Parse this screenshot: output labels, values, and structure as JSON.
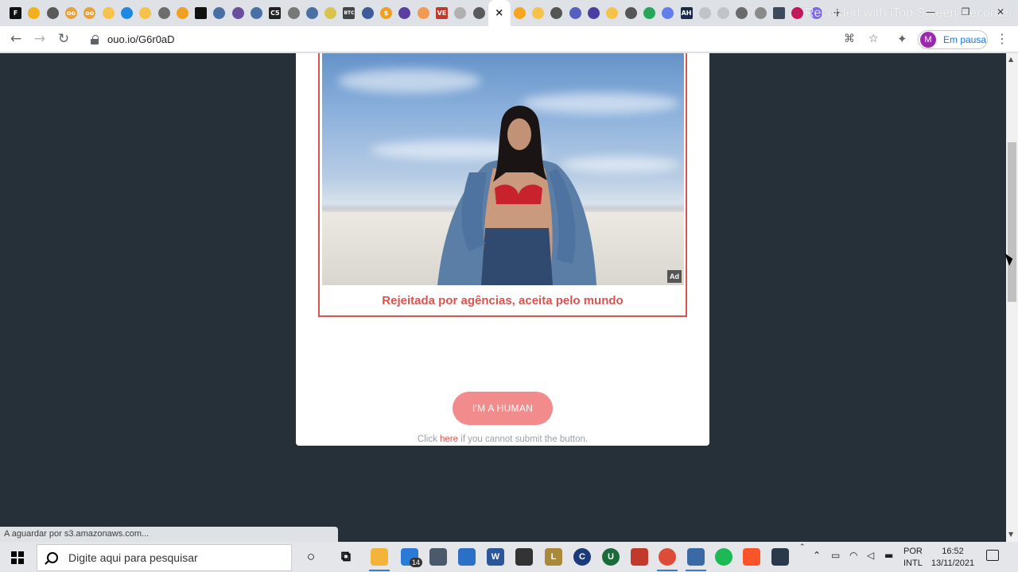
{
  "browser": {
    "tabs": [
      {
        "icon": "F",
        "color": "#111111",
        "shape": "square"
      },
      {
        "icon": "",
        "color": "#f2b01e"
      },
      {
        "icon": "",
        "color": "#5a5a5a"
      },
      {
        "icon": "oo",
        "color": "#e8a13a"
      },
      {
        "icon": "oo",
        "color": "#e8a13a"
      },
      {
        "icon": "",
        "color": "#f7c24a"
      },
      {
        "icon": "",
        "color": "#1e88e5"
      },
      {
        "icon": "",
        "color": "#f7c24a"
      },
      {
        "icon": "",
        "color": "#6d6d6d"
      },
      {
        "icon": "",
        "color": "#f0a020"
      },
      {
        "icon": "",
        "color": "#111111",
        "shape": "square"
      },
      {
        "icon": "",
        "color": "#4a6fa5"
      },
      {
        "icon": "",
        "color": "#6a4fa0"
      },
      {
        "icon": "",
        "color": "#4a6fa5"
      },
      {
        "icon": "C5",
        "color": "#222222",
        "shape": "square"
      },
      {
        "icon": "",
        "color": "#777777"
      },
      {
        "icon": "",
        "color": "#4a6fa5"
      },
      {
        "icon": "",
        "color": "#d9c34a"
      },
      {
        "icon": "BTC",
        "color": "#444444",
        "shape": "square"
      },
      {
        "icon": "",
        "color": "#3d5a99"
      },
      {
        "icon": "$",
        "color": "#f0a020"
      },
      {
        "icon": "",
        "color": "#5a3fa0"
      },
      {
        "icon": "",
        "color": "#f29a50"
      },
      {
        "icon": "VE",
        "color": "#c0392b",
        "shape": "square"
      },
      {
        "icon": "",
        "color": "#b0b0b0"
      },
      {
        "icon": "",
        "color": "#5a5a5a"
      },
      {
        "icon": "×",
        "color": "#ffffff",
        "active": true
      },
      {
        "icon": "",
        "color": "#f7a41e"
      },
      {
        "icon": "",
        "color": "#f7c24a"
      },
      {
        "icon": "",
        "color": "#555555"
      },
      {
        "icon": "",
        "color": "#5560c0"
      },
      {
        "icon": "",
        "color": "#4a3fa0"
      },
      {
        "icon": "",
        "color": "#f7c24a"
      },
      {
        "icon": "",
        "color": "#555555"
      },
      {
        "icon": "",
        "color": "#26a65b"
      },
      {
        "icon": "",
        "color": "#627eea"
      },
      {
        "icon": "AH",
        "color": "#1a2a4a",
        "shape": "square"
      },
      {
        "icon": "",
        "color": "#c0c4c8"
      },
      {
        "icon": "",
        "color": "#c0c4c8"
      },
      {
        "icon": "",
        "color": "#6a6a6a"
      },
      {
        "icon": "",
        "color": "#8a8a8a"
      },
      {
        "icon": "",
        "color": "#3c4a5a",
        "shape": "square"
      },
      {
        "icon": "",
        "color": "#c2185b"
      },
      {
        "icon": "",
        "color": "#7b68ee"
      }
    ],
    "new_tab_label": "+",
    "watermark": "Recorded with iTop Screen Recorder",
    "window_controls": {
      "minimize": "—",
      "maximize": "❐",
      "close": "✕"
    },
    "nav": {
      "back": "←",
      "forward": "→",
      "reload": "↻"
    },
    "url": "ouo.io/G6r0aD",
    "translate_icon": "⌘",
    "star_icon": "☆",
    "extensions_icon": "✦",
    "profile": {
      "initial": "M",
      "label": "Em pausa"
    },
    "menu_icon": "⋮"
  },
  "page": {
    "ad_badge": "Ad",
    "ad_caption": "Rejeitada por agências, aceita pelo mundo",
    "human_button": "I'M A HUMAN",
    "help": {
      "prefix": "Click ",
      "link": "here",
      "suffix": " if you cannot submit the button."
    }
  },
  "status_bar": "A aguardar por s3.amazonaws.com...",
  "taskbar": {
    "search_placeholder": "Digite aqui para pesquisar",
    "mail_badge": "14",
    "lang": {
      "line1": "POR",
      "line2": "INTL"
    },
    "clock": {
      "time": "16:52",
      "date": "13/11/2021"
    },
    "apps": [
      {
        "name": "cortana",
        "color": "#000000",
        "label": "○"
      },
      {
        "name": "task-view",
        "color": "#000000",
        "label": "⧉"
      },
      {
        "name": "file-explorer",
        "color": "#f2b53a",
        "label": ""
      },
      {
        "name": "mail",
        "color": "#2b7bd6",
        "label": ""
      },
      {
        "name": "camera",
        "color": "#4a5a6a",
        "label": ""
      },
      {
        "name": "calculator",
        "color": "#2b6fc7",
        "label": ""
      },
      {
        "name": "word",
        "color": "#2b579a",
        "label": "W"
      },
      {
        "name": "store",
        "color": "#333333",
        "label": ""
      },
      {
        "name": "league",
        "color": "#a88a3a",
        "label": "L"
      },
      {
        "name": "ccleaner",
        "color": "#1a3a7a",
        "label": "C"
      },
      {
        "name": "upwork",
        "color": "#1a6a3a",
        "label": "U"
      },
      {
        "name": "redapp",
        "color": "#c0392b",
        "label": ""
      },
      {
        "name": "chrome",
        "color": "#dd4b39",
        "label": ""
      },
      {
        "name": "monitor-app",
        "color": "#3a6aa5",
        "label": ""
      },
      {
        "name": "spotify",
        "color": "#1db954",
        "label": ""
      },
      {
        "name": "brave",
        "color": "#fb542b",
        "label": ""
      },
      {
        "name": "camera-app",
        "color": "#2a3a4a",
        "label": ""
      }
    ]
  }
}
